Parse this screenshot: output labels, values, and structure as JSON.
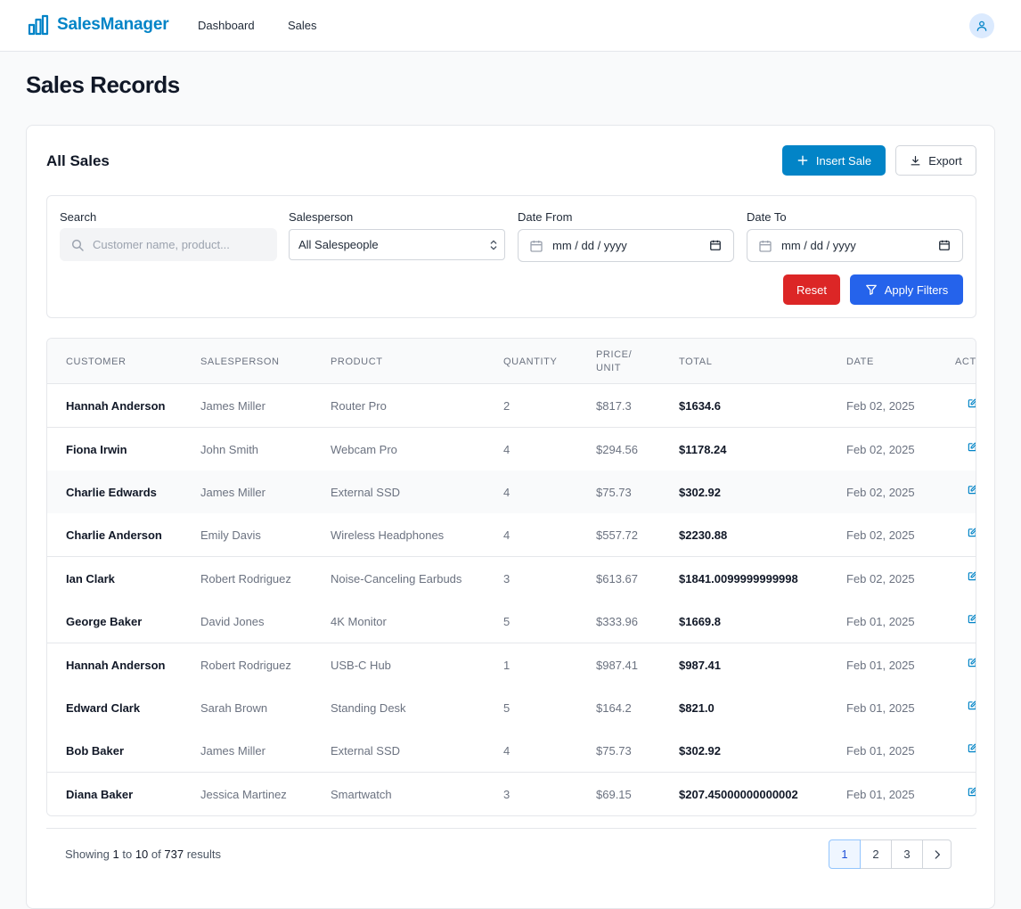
{
  "app": {
    "brand": "SalesManager",
    "nav": [
      "Dashboard",
      "Sales"
    ]
  },
  "page": {
    "title": "Sales Records"
  },
  "card": {
    "title": "All Sales",
    "insert_label": "Insert Sale",
    "export_label": "Export"
  },
  "filters": {
    "search_label": "Search",
    "search_placeholder": "Customer name, product...",
    "salesperson_label": "Salesperson",
    "salesperson_value": "All Salespeople",
    "date_from_label": "Date From",
    "date_from_value": "mm / dd / yyyy",
    "date_to_label": "Date To",
    "date_to_value": "mm / dd / yyyy",
    "reset_label": "Reset",
    "apply_label": "Apply Filters"
  },
  "table": {
    "headers": [
      "Customer",
      "Salesperson",
      "Product",
      "Quantity",
      "Price/",
      "Unit",
      "Total",
      "Date",
      "Act"
    ],
    "rows": [
      [
        "Hannah Anderson",
        "James Miller",
        "Router Pro",
        "2",
        "$817.3",
        "$1634.6",
        "Feb 02, 2025"
      ],
      [
        "Fiona Irwin",
        "John Smith",
        "Webcam Pro",
        "4",
        "$294.56",
        "$1178.24",
        "Feb 02, 2025"
      ],
      [
        "Charlie Edwards",
        "James Miller",
        "External SSD",
        "4",
        "$75.73",
        "$302.92",
        "Feb 02, 2025"
      ],
      [
        "Charlie Anderson",
        "Emily Davis",
        "Wireless Headphones",
        "4",
        "$557.72",
        "$2230.88",
        "Feb 02, 2025"
      ],
      [
        "Ian Clark",
        "Robert Rodriguez",
        "Noise-Canceling Earbuds",
        "3",
        "$613.67",
        "$1841.0099999999998",
        "Feb 02, 2025"
      ],
      [
        "George Baker",
        "David Jones",
        "4K Monitor",
        "5",
        "$333.96",
        "$1669.8",
        "Feb 01, 2025"
      ],
      [
        "Hannah Anderson",
        "Robert Rodriguez",
        "USB-C Hub",
        "1",
        "$987.41",
        "$987.41",
        "Feb 01, 2025"
      ],
      [
        "Edward Clark",
        "Sarah Brown",
        "Standing Desk",
        "5",
        "$164.2",
        "$821.0",
        "Feb 01, 2025"
      ],
      [
        "Bob Baker",
        "James Miller",
        "External SSD",
        "4",
        "$75.73",
        "$302.92",
        "Feb 01, 2025"
      ],
      [
        "Diana Baker",
        "Jessica Martinez",
        "Smartwatch",
        "3",
        "$69.15",
        "$207.45000000000002",
        "Feb 01, 2025"
      ]
    ]
  },
  "pagination": {
    "showing_prefix": "Showing",
    "from": "1",
    "to_word": "to",
    "to": "10",
    "of_word": "of",
    "total": "737",
    "suffix": "results",
    "pages": [
      "1",
      "2",
      "3"
    ],
    "active_page": "1"
  },
  "colors": {
    "brand": "#0284c7",
    "insert_button": "#0284c7",
    "reset_button": "#dc2626",
    "apply_button": "#2563eb",
    "edit_icon": "#0284c7"
  }
}
